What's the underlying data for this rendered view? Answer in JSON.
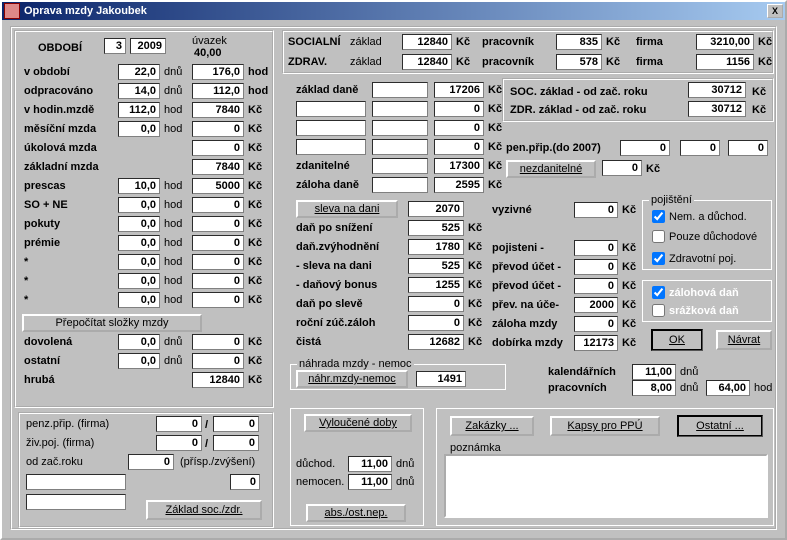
{
  "title": "Oprava mzdy Jakoubek",
  "close": "X",
  "obdobi": {
    "lbl": "OBDOBÍ",
    "month": "3",
    "year": "2009",
    "uvazek_lbl": "úvazek",
    "uvazek": "40,00"
  },
  "left_rows": [
    {
      "lbl": "v období",
      "a": "22,0",
      "u": "dnů",
      "b": "176,0",
      "s": "hod"
    },
    {
      "lbl": "odpracováno",
      "a": "14,0",
      "u": "dnů",
      "b": "112,0",
      "s": "hod"
    },
    {
      "lbl": "v hodin.mzdě",
      "a": "112,0",
      "u": "hod",
      "b": "7840",
      "s": "Kč"
    },
    {
      "lbl": "měsíční mzda",
      "a": "0,0",
      "u": "hod",
      "b": "0",
      "s": "Kč"
    },
    {
      "lbl": "úkolová mzda",
      "a": "",
      "u": "",
      "b": "0",
      "s": "Kč"
    },
    {
      "lbl": "základní mzda",
      "a": "",
      "u": "",
      "b": "7840",
      "s": "Kč"
    },
    {
      "lbl": "prescas",
      "a": "10,0",
      "u": "hod",
      "b": "5000",
      "s": "Kč"
    },
    {
      "lbl": "SO + NE",
      "a": "0,0",
      "u": "hod",
      "b": "0",
      "s": "Kč"
    },
    {
      "lbl": "pokuty",
      "a": "0,0",
      "u": "hod",
      "b": "0",
      "s": "Kč"
    },
    {
      "lbl": "prémie",
      "a": "0,0",
      "u": "hod",
      "b": "0",
      "s": "Kč"
    },
    {
      "lbl": "*",
      "a": "0,0",
      "u": "hod",
      "b": "0",
      "s": "Kč"
    },
    {
      "lbl": "*",
      "a": "0,0",
      "u": "hod",
      "b": "0",
      "s": "Kč"
    },
    {
      "lbl": "*",
      "a": "0,0",
      "u": "hod",
      "b": "0",
      "s": "Kč"
    }
  ],
  "prepocitat": "Přepočítat složky mzdy",
  "left_rows2": [
    {
      "lbl": "dovolená",
      "a": "0,0",
      "u": "dnů",
      "b": "0",
      "s": "Kč"
    },
    {
      "lbl": "ostatní",
      "a": "0,0",
      "u": "dnů",
      "b": "0",
      "s": "Kč"
    },
    {
      "lbl": "hrubá",
      "a": "",
      "u": "",
      "b": "12840",
      "s": "Kč"
    }
  ],
  "penz": {
    "l1": "penz.přip. (firma)",
    "v1a": "0",
    "v1b": "0",
    "l2": "živ.poj. (firma)",
    "v2a": "0",
    "v2b": "0",
    "l3": "od zač.roku",
    "v3": "0",
    "l3b": "(přísp./zvýšení)",
    "btn": "Základ soc./zdr.",
    "blank": "0"
  },
  "top": {
    "soc": "SOCIALNÍ",
    "zdr": "ZDRAV.",
    "zaklad": "základ",
    "prac": "pracovník",
    "firma": "firma",
    "kc": "Kč",
    "soc_z": "12840",
    "soc_p": "835",
    "soc_f": "3210,00",
    "zdr_z": "12840",
    "zdr_p": "578",
    "zdr_f": "1156"
  },
  "mid_left": [
    {
      "lbl": "základ daně",
      "a": "",
      "b": "17206"
    },
    {
      "lbl": "",
      "a": "",
      "b": "0"
    },
    {
      "lbl": "",
      "a": "",
      "b": "0"
    },
    {
      "lbl": "",
      "a": "",
      "b": "0"
    },
    {
      "lbl": "zdanitelné",
      "a": "",
      "b": "17300"
    },
    {
      "lbl": "záloha daně",
      "a": "",
      "b": "2595"
    }
  ],
  "yr": {
    "soc_l": "SOC. základ - od zač. roku",
    "soc_v": "30712",
    "zdr_l": "ZDR. základ - od zač. roku",
    "zdr_v": "30712",
    "kc": "Kč"
  },
  "pen07": {
    "lbl": "pen.přip.(do 2007)",
    "a": "0",
    "b": "0",
    "c": "0"
  },
  "nezd": {
    "btn": "nezdanitelné",
    "v": "0",
    "kc": "Kč"
  },
  "sleva_btn": "sleva na dani",
  "sleva_v": "2070",
  "dedu": [
    {
      "lbl": "daň po snížení",
      "v": "525"
    },
    {
      "lbl": "daň.zvýhodnění",
      "v": "1780"
    },
    {
      "lbl": "- sleva na dani",
      "v": "525"
    },
    {
      "lbl": "- daňový bonus",
      "v": "1255"
    },
    {
      "lbl": "daň po slevě",
      "v": "0"
    },
    {
      "lbl": "roční zúč.záloh",
      "v": "0"
    },
    {
      "lbl": "čistá",
      "v": "12682"
    }
  ],
  "right": [
    {
      "lbl": "vyzivné",
      "v": "0"
    },
    {
      "lbl": "",
      "v": ""
    },
    {
      "lbl": "pojisteni   -",
      "v": "0"
    },
    {
      "lbl": "převod účet -",
      "v": "0"
    },
    {
      "lbl": "převod účet -",
      "v": "0"
    },
    {
      "lbl": "přev. na úče-",
      "v": "2000"
    },
    {
      "lbl": "záloha mzdy",
      "v": "0"
    },
    {
      "lbl": "dobírka mzdy",
      "v": "12173"
    }
  ],
  "poj": {
    "legend": "pojištění",
    "c1": "Nem. a důchod.",
    "c2": "Pouze důchodové",
    "c3": "Zdravotní poj.",
    "c4": "zálohová daň",
    "c5": "srážková daň"
  },
  "ok": "OK",
  "navrat": "Návrat",
  "nahr": {
    "legend": "náhrada mzdy - nemoc",
    "btn": "náhr.mzdy-nemoc",
    "v": "1491",
    "kal_l": "kalendářních",
    "kal_v": "11,00",
    "dnu": "dnů",
    "prac_l": "pracovních",
    "prac_v": "8,00",
    "hod_v": "64,00",
    "hod": "hod"
  },
  "vyl": {
    "btn": "Vyloučené doby",
    "duch_l": "důchod.",
    "duch_v": "11,00",
    "nem_l": "nemocen.",
    "nem_v": "11,00",
    "dnu": "dnů",
    "abs": "abs./ost.nep."
  },
  "zak": "Zakázky ...",
  "kapsy": "Kapsy pro PPÚ",
  "ost": "Ostatní ...",
  "pozn": "poznámka",
  "kc": "Kč"
}
